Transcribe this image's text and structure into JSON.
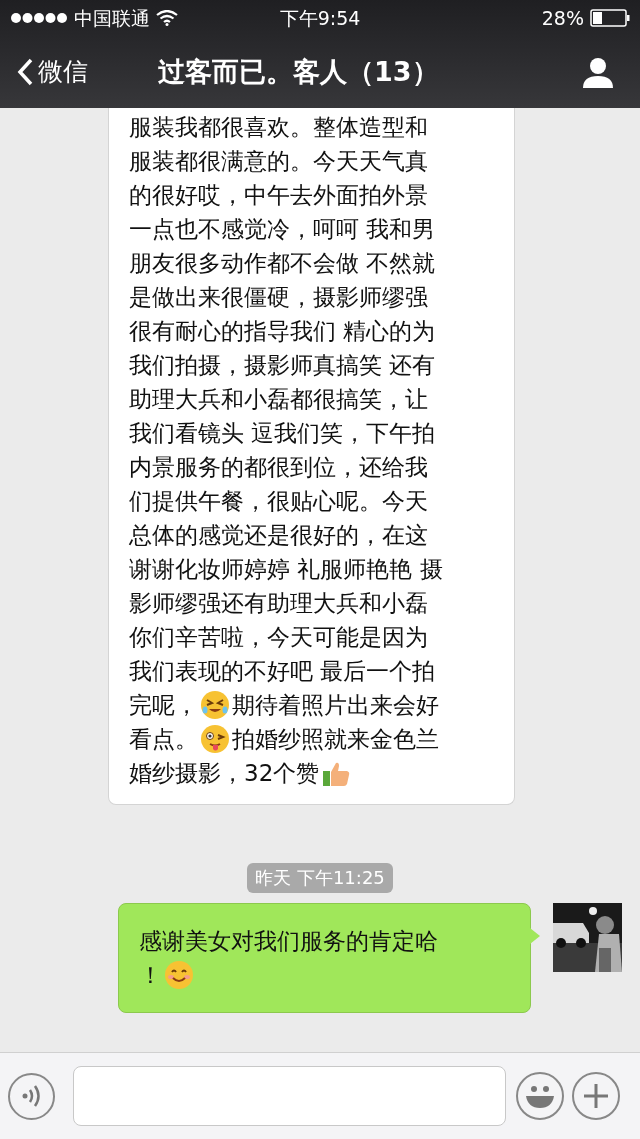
{
  "status_bar": {
    "carrier": "中国联通",
    "time": "下午9:54",
    "battery": "28%"
  },
  "nav": {
    "back": "微信",
    "title": "过客而已。客人（13）"
  },
  "messages": [
    {
      "kind": "received",
      "lines": [
        [
          {
            "kind": "text",
            "text": "服装我都很喜欢。整体造型和"
          }
        ],
        [
          {
            "kind": "text",
            "text": "服装都很满意的。今天天气真"
          }
        ],
        [
          {
            "kind": "text",
            "text": "的很好哎，中午去外面拍外景"
          }
        ],
        [
          {
            "kind": "text",
            "text": "一点也不感觉冷，呵呵 我和男"
          }
        ],
        [
          {
            "kind": "text",
            "text": "朋友很多动作都不会做 不然就"
          }
        ],
        [
          {
            "kind": "text",
            "text": "是做出来很僵硬，摄影师缪强"
          }
        ],
        [
          {
            "kind": "text",
            "text": "很有耐心的指导我们 精心的为"
          }
        ],
        [
          {
            "kind": "text",
            "text": "我们拍摄，摄影师真搞笑 还有"
          }
        ],
        [
          {
            "kind": "text",
            "text": "助理大兵和小磊都很搞笑，让"
          }
        ],
        [
          {
            "kind": "text",
            "text": "我们看镜头 逗我们笑，下午拍"
          }
        ],
        [
          {
            "kind": "text",
            "text": "内景服务的都很到位，还给我"
          }
        ],
        [
          {
            "kind": "text",
            "text": "们提供午餐，很贴心呢。今天"
          }
        ],
        [
          {
            "kind": "text",
            "text": "总体的感觉还是很好的，在这"
          }
        ],
        [
          {
            "kind": "text",
            "text": "谢谢化妆师婷婷 礼服师艳艳 摄"
          }
        ],
        [
          {
            "kind": "text",
            "text": "影师缪强还有助理大兵和小磊"
          }
        ],
        [
          {
            "kind": "text",
            "text": "你们辛苦啦，今天可能是因为"
          }
        ],
        [
          {
            "kind": "text",
            "text": "我们表现的不好吧 最后一个拍"
          }
        ],
        [
          {
            "kind": "text",
            "text": "完呢，"
          },
          {
            "kind": "laughing"
          },
          {
            "kind": "text",
            "text": "期待着照片出来会好"
          }
        ],
        [
          {
            "kind": "text",
            "text": "看点。"
          },
          {
            "kind": "winking"
          },
          {
            "kind": "text",
            "text": "拍婚纱照就来金色兰"
          }
        ],
        [
          {
            "kind": "text",
            "text": "婚纱摄影，32个赞"
          },
          {
            "kind": "thumbsup"
          }
        ]
      ]
    },
    {
      "kind": "time",
      "text": "昨天 下午11:25"
    },
    {
      "kind": "sent",
      "lines": [
        [
          {
            "kind": "text",
            "text": "感谢美女对我们服务的肯定哈"
          }
        ],
        [
          {
            "kind": "text",
            "text": "！"
          },
          {
            "kind": "smiling"
          }
        ]
      ]
    }
  ]
}
